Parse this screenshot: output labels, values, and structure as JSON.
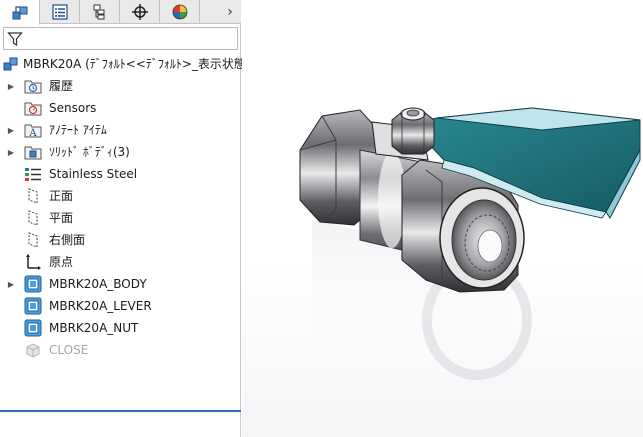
{
  "colors": {
    "accent": "#2f6db5",
    "lever_teal": "#1f7b85",
    "lever_light": "#bfe4ec",
    "body_metal": "#8d8f93"
  },
  "tabs": [
    {
      "name": "feature-manager",
      "icon": "feature-tree-icon"
    },
    {
      "name": "property-manager",
      "icon": "property-list-icon"
    },
    {
      "name": "configuration-manager",
      "icon": "configuration-icon"
    },
    {
      "name": "dimxpert-manager",
      "icon": "crosshair-icon"
    },
    {
      "name": "display-manager",
      "icon": "color-wheel-icon"
    }
  ],
  "tabs_more": "›",
  "filter": {
    "placeholder": "",
    "icon": "filter-icon"
  },
  "tree": {
    "root": "MBRK20A (ﾃﾞﾌｫﾙﾄ<<ﾃﾞﾌｫﾙﾄ>_表示状態",
    "items": [
      {
        "label": "履歴",
        "icon": "history-folder-icon",
        "expandable": true
      },
      {
        "label": "Sensors",
        "icon": "sensors-folder-icon",
        "expandable": false
      },
      {
        "label": "ｱﾉﾃｰﾄ ｱｲﾃﾑ",
        "icon": "annotations-folder-icon",
        "expandable": true
      },
      {
        "label": "ｿﾘｯﾄﾞ ﾎﾞﾃﾞｨ(3)",
        "icon": "solid-bodies-folder-icon",
        "expandable": true
      },
      {
        "label": "Stainless Steel",
        "icon": "material-icon",
        "expandable": false
      },
      {
        "label": "正面",
        "icon": "plane-icon",
        "expandable": false
      },
      {
        "label": "平面",
        "icon": "plane-icon",
        "expandable": false
      },
      {
        "label": "右側面",
        "icon": "plane-icon",
        "expandable": false
      },
      {
        "label": "原点",
        "icon": "origin-icon",
        "expandable": false
      },
      {
        "label": "MBRK20A_BODY",
        "icon": "part-icon",
        "expandable": true
      },
      {
        "label": "MBRK20A_LEVER",
        "icon": "part-icon",
        "expandable": false
      },
      {
        "label": "MBRK20A_NUT",
        "icon": "part-icon",
        "expandable": false
      },
      {
        "label": "CLOSE",
        "icon": "suppressed-feature-icon",
        "expandable": false,
        "dimmed": true
      }
    ]
  }
}
